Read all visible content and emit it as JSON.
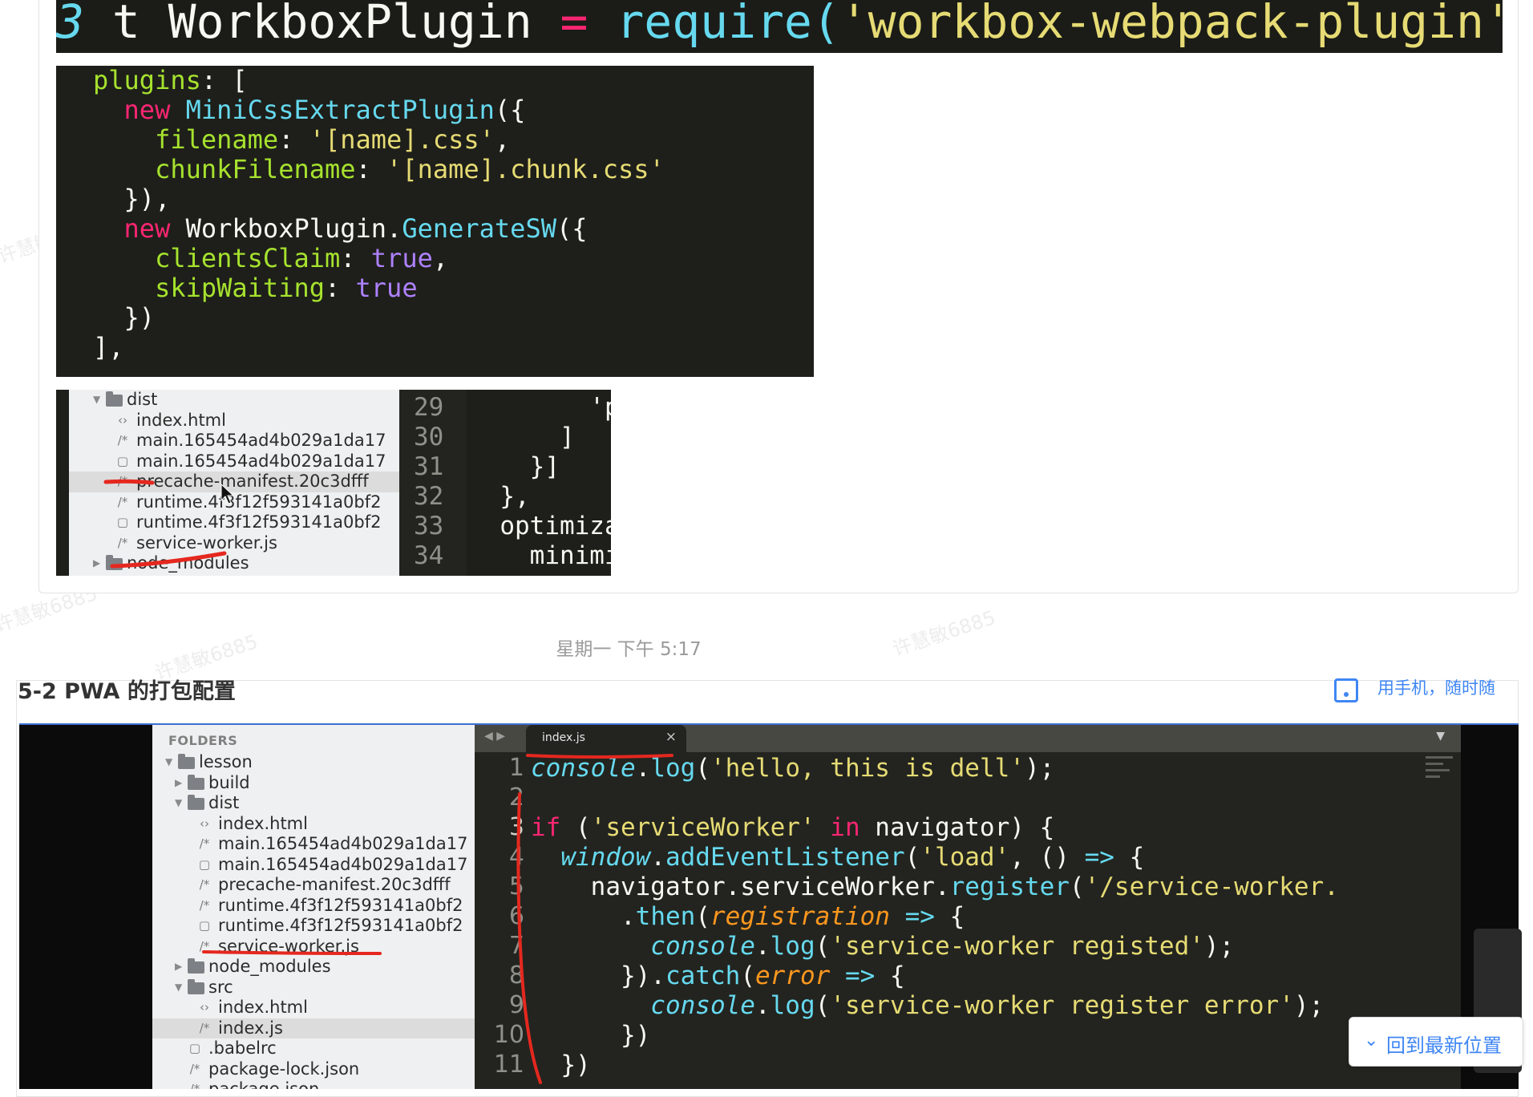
{
  "banner": {
    "text_prefix": "t WorkboxPlugin ",
    "text_eq": "=",
    "text_require": "require(",
    "text_str": "'workbox-webpack-plugin'",
    "text_close": ")"
  },
  "code1_lines": [
    {
      "parts": [
        [
          "pr",
          "plugins"
        ],
        [
          "wh",
          ": ["
        ]
      ]
    },
    {
      "parts": [
        [
          "kw",
          "  new "
        ],
        [
          "fn",
          "MiniCssExtractPlugin"
        ],
        [
          "wh",
          "({"
        ]
      ]
    },
    {
      "parts": [
        [
          "pr",
          "    filename"
        ],
        [
          "wh",
          ": "
        ],
        [
          "st",
          "'[name].css'"
        ],
        [
          "wh",
          ","
        ]
      ]
    },
    {
      "parts": [
        [
          "pr",
          "    chunkFilename"
        ],
        [
          "wh",
          ": "
        ],
        [
          "st",
          "'[name].chunk.css'"
        ]
      ]
    },
    {
      "parts": [
        [
          "wh",
          "  }),"
        ]
      ]
    },
    {
      "parts": [
        [
          "kw",
          "  new "
        ],
        [
          "wh",
          "WorkboxPlugin."
        ],
        [
          "fn",
          "GenerateSW"
        ],
        [
          "wh",
          "({"
        ]
      ]
    },
    {
      "parts": [
        [
          "pr",
          "    clientsClaim"
        ],
        [
          "wh",
          ": "
        ],
        [
          "nb",
          "true"
        ],
        [
          "wh",
          ","
        ]
      ]
    },
    {
      "parts": [
        [
          "pr",
          "    skipWaiting"
        ],
        [
          "wh",
          ": "
        ],
        [
          "nb",
          "true"
        ]
      ]
    },
    {
      "parts": [
        [
          "wh",
          "  })"
        ]
      ]
    },
    {
      "parts": [
        [
          "wh",
          "],"
        ]
      ]
    }
  ],
  "snip_tree": [
    {
      "type": "folder-open",
      "label": "dist",
      "indent": 0
    },
    {
      "type": "html",
      "label": "index.html",
      "indent": 1
    },
    {
      "type": "js",
      "label": "main.165454ad4b029a1da17",
      "indent": 1
    },
    {
      "type": "file",
      "label": "main.165454ad4b029a1da17",
      "indent": 1
    },
    {
      "type": "js",
      "label": "precache-manifest.20c3dfff",
      "indent": 1,
      "selected": true
    },
    {
      "type": "js",
      "label": "runtime.4f3f12f593141a0bf2",
      "indent": 1
    },
    {
      "type": "file",
      "label": "runtime.4f3f12f593141a0bf2",
      "indent": 1
    },
    {
      "type": "js",
      "label": "service-worker.js",
      "indent": 1
    },
    {
      "type": "folder-closed",
      "label": "node_modules",
      "indent": 0
    }
  ],
  "snip_code": [
    {
      "num": "29",
      "text": "        'p"
    },
    {
      "num": "30",
      "text": "      ]"
    },
    {
      "num": "31",
      "text": "    }]"
    },
    {
      "num": "32",
      "text": "  },"
    },
    {
      "num": "33",
      "text": "  optimiza",
      "cls": "pr"
    },
    {
      "num": "34",
      "text": "    minimi",
      "cls": "pr"
    }
  ],
  "timestamp": "星期一 下午 5:17",
  "card2": {
    "title": "5-2 PWA 的打包配置",
    "link": "用手机，随时随"
  },
  "sidebar": {
    "header": "FOLDERS",
    "items": [
      {
        "type": "folder-open",
        "label": "lesson",
        "indent": 0
      },
      {
        "type": "folder-closed",
        "label": "build",
        "indent": 1
      },
      {
        "type": "folder-open",
        "label": "dist",
        "indent": 1
      },
      {
        "type": "html",
        "label": "index.html",
        "indent": 2
      },
      {
        "type": "js",
        "label": "main.165454ad4b029a1da17",
        "indent": 2
      },
      {
        "type": "file",
        "label": "main.165454ad4b029a1da17",
        "indent": 2
      },
      {
        "type": "js",
        "label": "precache-manifest.20c3dfff",
        "indent": 2
      },
      {
        "type": "js",
        "label": "runtime.4f3f12f593141a0bf2",
        "indent": 2
      },
      {
        "type": "file",
        "label": "runtime.4f3f12f593141a0bf2",
        "indent": 2
      },
      {
        "type": "js",
        "label": "service-worker.js",
        "indent": 2
      },
      {
        "type": "folder-closed",
        "label": "node_modules",
        "indent": 1
      },
      {
        "type": "folder-open",
        "label": "src",
        "indent": 1
      },
      {
        "type": "html",
        "label": "index.html",
        "indent": 2
      },
      {
        "type": "js",
        "label": "index.js",
        "indent": 2,
        "selected": true
      },
      {
        "type": "file",
        "label": ".babelrc",
        "indent": 1
      },
      {
        "type": "js",
        "label": "package-lock.json",
        "indent": 1
      },
      {
        "type": "js",
        "label": "package.json",
        "indent": 1
      }
    ]
  },
  "editor": {
    "tab_name": "index.js",
    "tab_close": "×",
    "nav": "◀ ▶",
    "dropdown": "▼",
    "lines": [
      {
        "num": "1",
        "parts": [
          [
            "cs",
            "console"
          ],
          [
            "wh",
            "."
          ],
          [
            "fn",
            "log"
          ],
          [
            "wh",
            "("
          ],
          [
            "st",
            "'hello, this is dell'"
          ],
          [
            "wh",
            ");"
          ]
        ]
      },
      {
        "num": "2",
        "parts": []
      },
      {
        "num": "3",
        "parts": [
          [
            "kw",
            "if"
          ],
          [
            "wh",
            " ("
          ],
          [
            "st",
            "'serviceWorker'"
          ],
          [
            "kw",
            " in"
          ],
          [
            "wh",
            " navigator) {"
          ]
        ]
      },
      {
        "num": "4",
        "parts": [
          [
            "cs",
            "  window"
          ],
          [
            "wh",
            "."
          ],
          [
            "fn",
            "addEventListener"
          ],
          [
            "wh",
            "("
          ],
          [
            "st",
            "'load'"
          ],
          [
            "wh",
            ", () "
          ],
          [
            "fn",
            "=>"
          ],
          [
            "wh",
            " {"
          ]
        ]
      },
      {
        "num": "5",
        "parts": [
          [
            "wh",
            "    navigator."
          ],
          [
            "wh",
            "serviceWorker"
          ],
          [
            "wh",
            "."
          ],
          [
            "fn",
            "register"
          ],
          [
            "wh",
            "("
          ],
          [
            "st",
            "'/service-worker."
          ]
        ]
      },
      {
        "num": "6",
        "parts": [
          [
            "wh",
            "      ."
          ],
          [
            "fn",
            "then"
          ],
          [
            "wh",
            "("
          ],
          [
            "it",
            "registration"
          ],
          [
            "fn",
            " =>"
          ],
          [
            "wh",
            " {"
          ]
        ]
      },
      {
        "num": "7",
        "parts": [
          [
            "cs",
            "        console"
          ],
          [
            "wh",
            "."
          ],
          [
            "fn",
            "log"
          ],
          [
            "wh",
            "("
          ],
          [
            "st",
            "'service-worker registed'"
          ],
          [
            "wh",
            ");"
          ]
        ]
      },
      {
        "num": "8",
        "parts": [
          [
            "wh",
            "      })."
          ],
          [
            "fn",
            "catch"
          ],
          [
            "wh",
            "("
          ],
          [
            "it",
            "error"
          ],
          [
            "fn",
            " =>"
          ],
          [
            "wh",
            " {"
          ]
        ]
      },
      {
        "num": "9",
        "parts": [
          [
            "cs",
            "        console"
          ],
          [
            "wh",
            "."
          ],
          [
            "fn",
            "log"
          ],
          [
            "wh",
            "("
          ],
          [
            "st",
            "'service-worker register error'"
          ],
          [
            "wh",
            ");"
          ]
        ]
      },
      {
        "num": "10",
        "parts": [
          [
            "wh",
            "      })"
          ]
        ]
      },
      {
        "num": "11",
        "parts": [
          [
            "wh",
            "  })"
          ]
        ]
      }
    ]
  },
  "latest_button": {
    "chevron": "⌄",
    "label": "回到最新位置"
  },
  "watermark": "许慧敏6885",
  "colors": {
    "accent": "#3f86f3",
    "annotation": "#e5281f",
    "editor_bg": "#23241f"
  }
}
